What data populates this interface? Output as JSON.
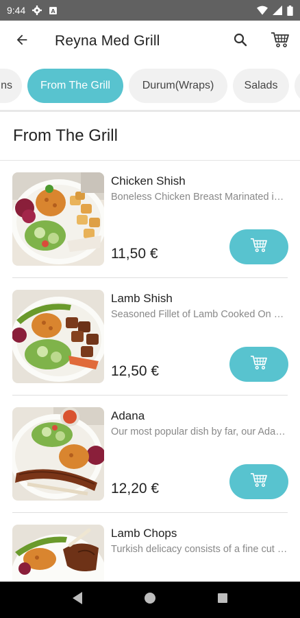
{
  "status_bar": {
    "time": "9:44",
    "icons": [
      "gear-icon",
      "a-badge-icon",
      "wifi-icon",
      "signal-icon",
      "battery-icon"
    ]
  },
  "app_bar": {
    "title": "Reyna Med Grill",
    "icons": [
      "back-arrow-icon",
      "search-icon",
      "cart-icon"
    ]
  },
  "categories": [
    {
      "label": "ns",
      "active": false
    },
    {
      "label": "From The Grill",
      "active": true
    },
    {
      "label": "Durum(Wraps)",
      "active": false
    },
    {
      "label": "Salads",
      "active": false
    },
    {
      "label": "",
      "active": false
    }
  ],
  "section": {
    "title": "From The Grill"
  },
  "items": [
    {
      "name": "Chicken Shish",
      "description": "Boneless Chicken Breast Marinated in our special sauce",
      "price": "11,50 €"
    },
    {
      "name": "Lamb Shish",
      "description": "Seasoned Fillet of Lamb Cooked On Charcoal",
      "price": "12,50 €"
    },
    {
      "name": "Adana",
      "description": "Our most popular dish by far, our Adana kebab",
      "price": "12,20 €"
    },
    {
      "name": "Lamb Chops",
      "description": "Turkish delicacy consists of a fine cut of lamb",
      "price": ""
    }
  ],
  "colors": {
    "accent": "#58c3cf",
    "status_bar": "#616161",
    "nav_bar": "#000000"
  }
}
